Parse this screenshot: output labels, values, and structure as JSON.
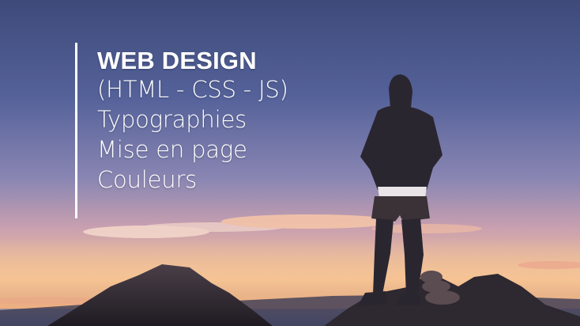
{
  "banner": {
    "heading": "WEB DESIGN",
    "lines": [
      "(HTML - CSS - JS)",
      "Typographies",
      "Mise en page",
      "Couleurs"
    ]
  },
  "colors": {
    "sky_top": "#3d4a7a",
    "sunset_glow": "#f3c79b",
    "silhouette": "#2a2630",
    "text": "#ffffff"
  }
}
